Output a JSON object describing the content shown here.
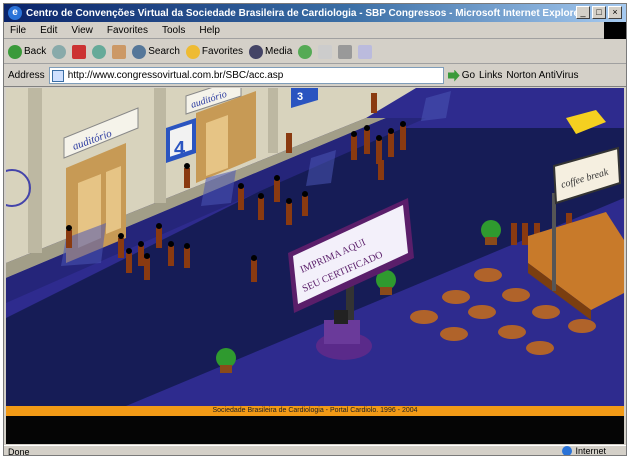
{
  "window": {
    "title": "Centro de Convenções Virtual da Sociedade Brasileira de Cardiologia - SBP Congressos - Microsoft Internet Explorer"
  },
  "menu": {
    "items": [
      "File",
      "Edit",
      "View",
      "Favorites",
      "Tools",
      "Help"
    ]
  },
  "toolbar": {
    "back_label": "Back",
    "search_label": "Search",
    "favorites_label": "Favorites",
    "media_label": "Media"
  },
  "address": {
    "label": "Address",
    "url": "http://www.congressovirtual.com.br/SBC/acc.asp",
    "go_label": "Go",
    "links_label": "Links",
    "norton_label": "Norton AntiVirus"
  },
  "scene": {
    "auditorio_sign_1": "auditório",
    "auditorio_sign_2": "auditório",
    "room_number_left": "4",
    "room_number_right": "3",
    "billboard_line1": "IMPRIMA AQUI",
    "billboard_line2": "SEU CERTIFICADO",
    "cafe_sign": "coffee break"
  },
  "footer": {
    "text": "Sociedade Brasileira de Cardiologia - Portal Cardiolo. 1996 - 2004"
  },
  "status": {
    "left": "Done",
    "zone": "Internet"
  },
  "colors": {
    "floor": "#2e2b8e",
    "aisle": "#141a4a",
    "wall": "#d8d3bd",
    "footer": "#f29a16"
  }
}
